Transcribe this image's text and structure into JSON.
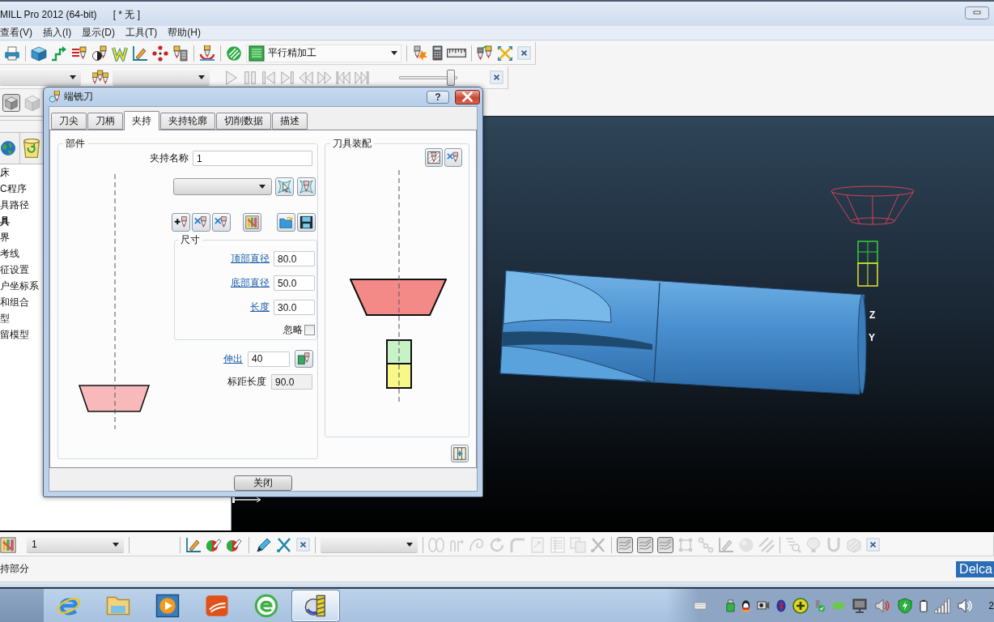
{
  "window": {
    "title": "MILL Pro 2012 (64-bit)",
    "document": "[ * 无 ]"
  },
  "menu": [
    {
      "label": "查看(V)"
    },
    {
      "label": "插入(I)"
    },
    {
      "label": "显示(D)"
    },
    {
      "label": "工具(T)"
    },
    {
      "label": "帮助(H)"
    }
  ],
  "main_toolbar": {
    "strategy": "平行精加工"
  },
  "playback_toolbar": {
    "buttons": [
      {
        "disabled": true
      },
      {
        "disabled": true
      },
      {
        "disabled": true
      },
      {
        "disabled": true
      },
      {
        "disabled": true
      },
      {
        "disabled": true
      },
      {
        "disabled": true
      },
      {
        "disabled": true
      }
    ],
    "slider": {
      "level": 0.97
    }
  },
  "explorer": {
    "view_buttons": [
      {
        "pressed": true,
        "disabled": false
      },
      {
        "pressed": false,
        "disabled": true
      }
    ],
    "items": [
      {
        "label": "床",
        "active": false
      },
      {
        "label": "C程序",
        "active": false
      },
      {
        "label": "具路径",
        "active": false
      },
      {
        "label": "具",
        "active": true
      },
      {
        "label": "界",
        "active": false
      },
      {
        "label": "考线",
        "active": false
      },
      {
        "label": "征设置",
        "active": false
      },
      {
        "label": "户坐标系",
        "active": false
      },
      {
        "label": "和组合",
        "active": false
      },
      {
        "label": "型",
        "active": false
      },
      {
        "label": "留模型",
        "active": false
      }
    ]
  },
  "dialog": {
    "title": "端铣刀",
    "help_button": "?",
    "tabs": [
      {
        "label": "刀尖",
        "selected": false
      },
      {
        "label": "刀柄",
        "selected": false
      },
      {
        "label": "夹持",
        "selected": true
      },
      {
        "label": "夹持轮廓",
        "selected": false
      },
      {
        "label": "切削数据",
        "selected": false
      },
      {
        "label": "描述",
        "selected": false
      }
    ],
    "parts": {
      "title": "部件",
      "holder_name": {
        "label": "夹持名称",
        "value": "1"
      },
      "dimensions": {
        "title": "尺寸",
        "fields": [
          {
            "label": "顶部直径",
            "value": "80.0"
          },
          {
            "label": "底部直径",
            "value": "50.0"
          },
          {
            "label": "长度",
            "value": "30.0"
          }
        ],
        "ignore": {
          "label": "忽略",
          "checked": false
        }
      },
      "overhang": {
        "label": "伸出",
        "value": "40"
      },
      "gauge_length": {
        "label": "标距长度",
        "value": "90.0",
        "readonly": true
      }
    },
    "assembly": {
      "title": "刀具装配"
    },
    "close_button": "关闭"
  },
  "viewport": {
    "axis_labels": [
      "Z",
      "Y"
    ]
  },
  "bottom_toolbar": {
    "combo": "1",
    "buttons": [
      {
        "disabled": false,
        "pressed": false
      },
      {
        "disabled": false,
        "pressed": false
      },
      {
        "disabled": false,
        "pressed": false
      },
      {
        "disabled": false,
        "pressed": false
      },
      {
        "disabled": false,
        "pressed": false
      },
      {
        "disabled": true,
        "pressed": false
      },
      {
        "disabled": true,
        "pressed": false
      },
      {
        "disabled": true,
        "pressed": false
      },
      {
        "disabled": true,
        "pressed": false
      },
      {
        "disabled": true,
        "pressed": false
      },
      {
        "disabled": true,
        "pressed": false
      },
      {
        "disabled": true,
        "pressed": false
      },
      {
        "disabled": true,
        "pressed": false
      },
      {
        "disabled": true,
        "pressed": false
      },
      {
        "disabled": false,
        "pressed": true
      },
      {
        "disabled": false,
        "pressed": true
      },
      {
        "disabled": false,
        "pressed": true
      },
      {
        "disabled": true,
        "pressed": false
      },
      {
        "disabled": true,
        "pressed": false
      },
      {
        "disabled": true,
        "pressed": false
      },
      {
        "disabled": true,
        "pressed": false
      },
      {
        "disabled": true,
        "pressed": false
      },
      {
        "disabled": true,
        "pressed": false
      },
      {
        "disabled": true,
        "pressed": false
      },
      {
        "disabled": true,
        "pressed": false
      },
      {
        "disabled": true,
        "pressed": false
      }
    ]
  },
  "status_bar": {
    "message": "持部分",
    "brand": "Delca"
  },
  "taskbar": {
    "apps": [
      {
        "selected": false
      },
      {
        "selected": false
      },
      {
        "selected": false
      },
      {
        "selected": false
      },
      {
        "selected": false
      },
      {
        "selected": true
      }
    ],
    "clock": "2"
  }
}
